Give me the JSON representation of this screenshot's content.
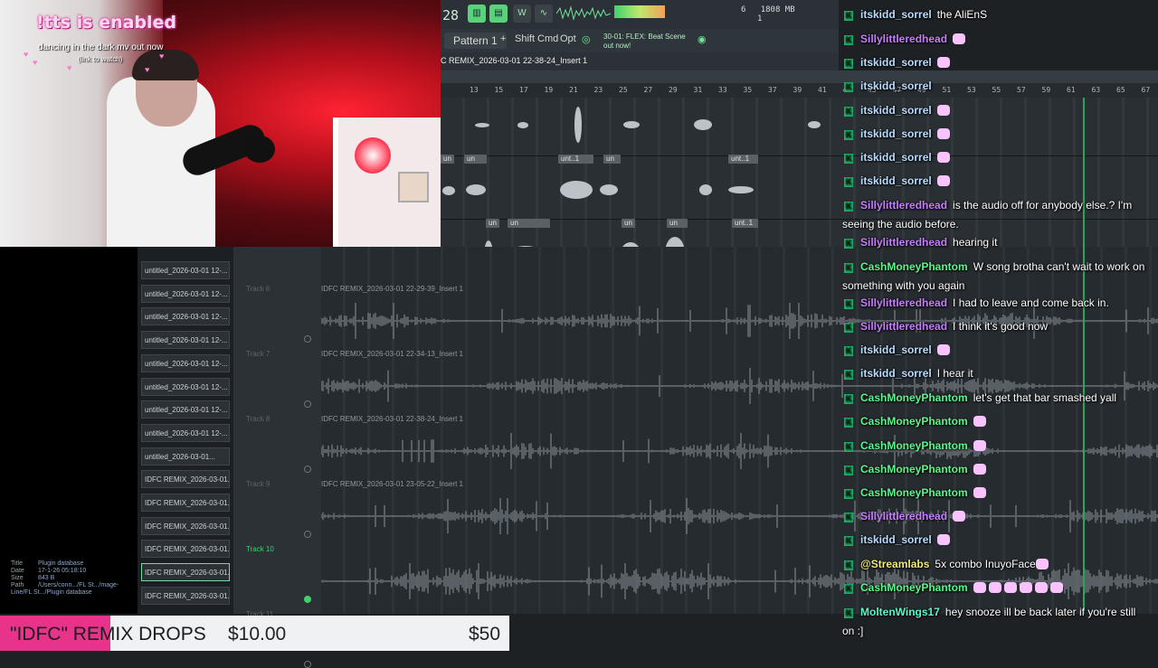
{
  "webcam": {
    "tts_title": "!tts is enabled",
    "tts_line1": "dancing in the dark mv out now",
    "tts_line2": "(link to watch)"
  },
  "daw": {
    "bar_number": "28",
    "toolbar_icons": [
      "pattern-mode-icon",
      "song-mode-icon",
      "wait-icon",
      "tempo-icon"
    ],
    "cpu_readout": "1808 MB",
    "cpu_line2": "6",
    "cpu_line3": "1",
    "pattern_label": "Pattern 1",
    "pattern_add": "+",
    "menu_buttons": [
      "Shift",
      "Cmd",
      "Opt"
    ],
    "news_line1": "30-01: FLEX: Beat Scene",
    "news_line2": "out now!",
    "breadcrumb": "C REMIX_2026-03-01 22-38-24_Insert 1",
    "ruler_ticks": [
      "13",
      "15",
      "17",
      "19",
      "21",
      "23",
      "25",
      "27",
      "29",
      "31",
      "33",
      "35",
      "37",
      "39",
      "41",
      "43",
      "45",
      "47",
      "49",
      "51",
      "53",
      "55",
      "57",
      "59",
      "61",
      "63",
      "65",
      "67"
    ],
    "top_clip_labels": [
      "un",
      "unt..1",
      "un",
      "unt..1",
      "un",
      "un",
      "un",
      "unt..1",
      "un"
    ],
    "tracks": [
      {
        "label": "Track 6",
        "clip": "IDFC REMIX_2026-03-01 22-29-39_Insert 1"
      },
      {
        "label": "Track 7",
        "clip": "IDFC REMIX_2026-03-01 22-34-13_Insert 1"
      },
      {
        "label": "Track 8",
        "clip": "IDFC REMIX_2026-03-01 22-38-24_Insert 1"
      },
      {
        "label": "Track 9",
        "clip": "IDFC REMIX_2026-03-01 23-05-22_Insert 1"
      },
      {
        "label": "Track 10",
        "clip": ""
      },
      {
        "label": "Track 11",
        "clip": ""
      }
    ]
  },
  "browser": {
    "files": [
      "untitled_2026-03-01 12-...",
      "untitled_2026-03-01 12-...",
      "untitled_2026-03-01 12-...",
      "untitled_2026-03-01 12-...",
      "untitled_2026-03-01 12-...",
      "untitled_2026-03-01 12-...",
      "untitled_2026-03-01 12-...",
      "untitled_2026-03-01 12-...",
      "untitled_2026-03-01...",
      "IDFC REMIX_2026-03-01...",
      "IDFC REMIX_2026-03-01...",
      "IDFC REMIX_2026-03-01...",
      "IDFC REMIX_2026-03-01...",
      "IDFC REMIX_2026-03-01...",
      "IDFC REMIX_2026-03-01..."
    ],
    "info": {
      "title_key": "Title",
      "title_val": "Plugin database",
      "date_key": "Date",
      "date_val": "17-1-26 05:18:10",
      "size_key": "Size",
      "size_val": "843 B",
      "path_key": "Path",
      "path_val": "/Users/conn.../FL St.../mage-Line/FL St.../Plugin database"
    }
  },
  "chat": [
    {
      "user": "itskidd_sorrel",
      "color": "#b9dcff",
      "text": "the AliEnS",
      "emotes": 0
    },
    {
      "user": "Sillylittleredhead",
      "color": "#c77dff",
      "text": "",
      "emotes": 1
    },
    {
      "user": "itskidd_sorrel",
      "color": "#b9dcff",
      "text": "",
      "emotes": 1
    },
    {
      "user": "itskidd_sorrel",
      "color": "#b9dcff",
      "text": "",
      "emotes": 0
    },
    {
      "user": "itskidd_sorrel",
      "color": "#b9dcff",
      "text": "",
      "emotes": 1
    },
    {
      "user": "itskidd_sorrel",
      "color": "#b9dcff",
      "text": "",
      "emotes": 1
    },
    {
      "user": "itskidd_sorrel",
      "color": "#b9dcff",
      "text": "",
      "emotes": 1
    },
    {
      "user": "itskidd_sorrel",
      "color": "#b9dcff",
      "text": "",
      "emotes": 1
    },
    {
      "user": "Sillylittleredhead",
      "color": "#c77dff",
      "text": "is the audio off for anybody else.? I'm seeing the audio before.",
      "emotes": 0
    },
    {
      "user": "Sillylittleredhead",
      "color": "#c77dff",
      "text": "hearing it",
      "emotes": 0
    },
    {
      "user": "CashMoneyPhantom",
      "color": "#5cf78c",
      "text": "W song brotha can't wait to work on something with you again",
      "emotes": 0
    },
    {
      "user": "Sillylittleredhead",
      "color": "#c77dff",
      "text": "I had to leave and come back in.",
      "emotes": 0
    },
    {
      "user": "Sillylittleredhead",
      "color": "#c77dff",
      "text": "I think it's good now",
      "emotes": 0
    },
    {
      "user": "itskidd_sorrel",
      "color": "#b9dcff",
      "text": "",
      "emotes": 1
    },
    {
      "user": "itskidd_sorrel",
      "color": "#b9dcff",
      "text": "I hear it",
      "emotes": 0
    },
    {
      "user": "CashMoneyPhantom",
      "color": "#5cf78c",
      "text": "let's get that bar smashed yall",
      "emotes": 0
    },
    {
      "user": "CashMoneyPhantom",
      "color": "#5cf78c",
      "text": "",
      "emotes": 1
    },
    {
      "user": "CashMoneyPhantom",
      "color": "#5cf78c",
      "text": "",
      "emotes": 1
    },
    {
      "user": "CashMoneyPhantom",
      "color": "#5cf78c",
      "text": "",
      "emotes": 1
    },
    {
      "user": "CashMoneyPhantom",
      "color": "#5cf78c",
      "text": "",
      "emotes": 1
    },
    {
      "user": "Sillylittleredhead",
      "color": "#c77dff",
      "text": "",
      "emotes": 1
    },
    {
      "user": "itskidd_sorrel",
      "color": "#b9dcff",
      "text": "",
      "emotes": 1
    },
    {
      "user": "@Streamlabs",
      "color": "#f2e97a",
      "text": "5x  combo InuyoFace",
      "emotes": 1
    },
    {
      "user": "CashMoneyPhantom",
      "color": "#5cf78c",
      "text": "",
      "emotes": 6
    },
    {
      "user": "MoltenWings17",
      "color": "#5cf7c8",
      "text": "hey snooze ill be back later if you're still on :]",
      "emotes": 0
    }
  ],
  "ticker": {
    "title": "\"IDFC\" REMIX DROPS",
    "amount": "$10.00",
    "goal": "$50"
  },
  "colors": {
    "accent_green": "#3fd16e",
    "ticker_pink": "#e8338b",
    "chat_badge": "#1fb26b"
  }
}
